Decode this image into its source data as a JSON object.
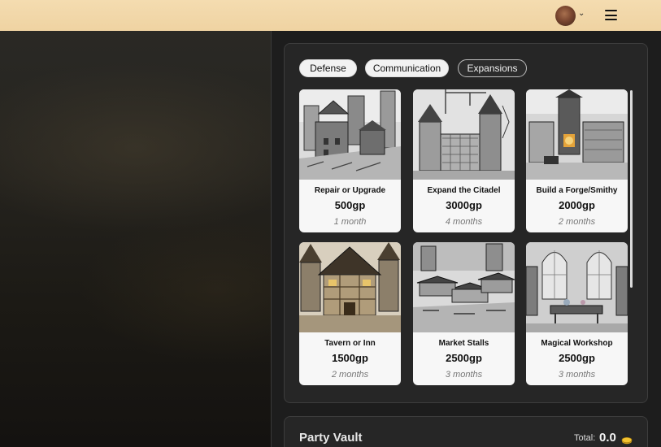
{
  "header": {
    "avatar": "user-avatar",
    "menu_icon": "hamburger-menu-icon"
  },
  "tabs": [
    {
      "label": "Defense",
      "active": false
    },
    {
      "label": "Communication",
      "active": false
    },
    {
      "label": "Expansions",
      "active": true
    }
  ],
  "cards": [
    {
      "name": "Repair or Upgrade",
      "price": "500gp",
      "time": "1 month",
      "image": "castle-repair-illustration"
    },
    {
      "name": "Expand the Citadel",
      "price": "3000gp",
      "time": "4 months",
      "image": "citadel-construction-illustration"
    },
    {
      "name": "Build a Forge/Smithy",
      "price": "2000gp",
      "time": "2 months",
      "image": "forge-smithy-illustration"
    },
    {
      "name": "Tavern or Inn",
      "price": "1500gp",
      "time": "2 months",
      "image": "tavern-inn-illustration"
    },
    {
      "name": "Market Stalls",
      "price": "2500gp",
      "time": "3 months",
      "image": "market-stalls-illustration"
    },
    {
      "name": "Magical Workshop",
      "price": "2500gp",
      "time": "3 months",
      "image": "magical-workshop-illustration"
    }
  ],
  "vault": {
    "title": "Party Vault",
    "total_label": "Total:",
    "total_value": "0.0",
    "coin_icon": "gold-coin-icon"
  },
  "colors": {
    "header": "#f4dcb0",
    "panel": "#262626",
    "card": "#f7f7f7"
  }
}
